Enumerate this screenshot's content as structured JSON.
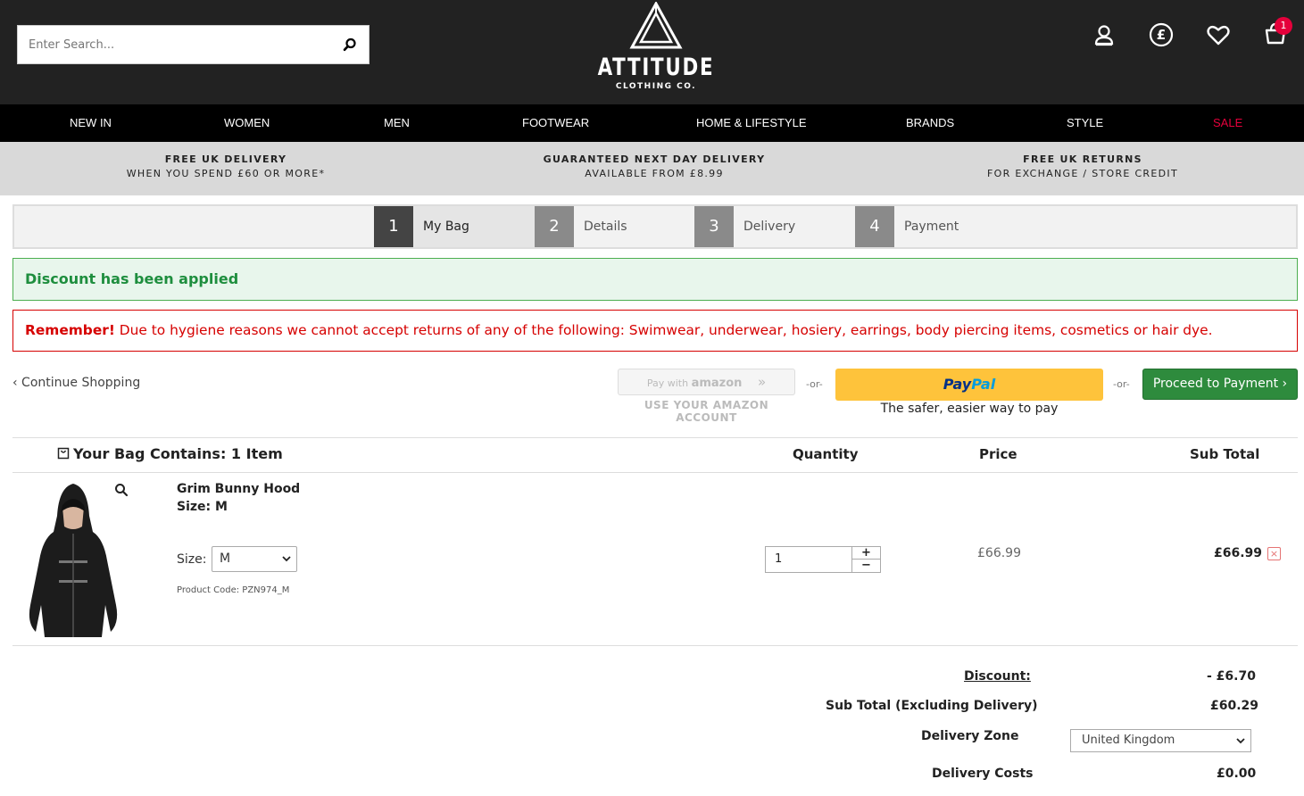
{
  "header": {
    "search_placeholder": "Enter Search...",
    "logo_name": "ATTITUDE",
    "logo_sub": "CLOTHING CO.",
    "cart_count": "1",
    "currency_symbol": "£"
  },
  "nav": {
    "items": [
      "NEW IN",
      "WOMEN",
      "MEN",
      "FOOTWEAR",
      "HOME & LIFESTYLE",
      "BRANDS",
      "STYLE",
      "SALE"
    ]
  },
  "promo": [
    {
      "title": "FREE UK DELIVERY",
      "sub": "WHEN YOU SPEND £60 OR MORE*"
    },
    {
      "title": "GUARANTEED NEXT DAY DELIVERY",
      "sub": "AVAILABLE FROM £8.99"
    },
    {
      "title": "FREE UK RETURNS",
      "sub": "FOR EXCHANGE / STORE CREDIT"
    }
  ],
  "steps": [
    {
      "num": "1",
      "label": "My Bag"
    },
    {
      "num": "2",
      "label": "Details"
    },
    {
      "num": "3",
      "label": "Delivery"
    },
    {
      "num": "4",
      "label": "Payment"
    }
  ],
  "alerts": {
    "discount": "Discount has been applied",
    "remember_bold": "Remember!",
    "remember_text": " Due to hygiene reasons we cannot accept returns of any of the following: Swimwear, underwear, hosiery, earrings, body piercing items, cosmetics or hair dye."
  },
  "actions": {
    "continue": "‹ Continue Shopping",
    "amazon_pay_with": "Pay with",
    "amazon_brand": "amazon",
    "amazon_sub": "USE YOUR AMAZON ACCOUNT",
    "or": "-or-",
    "paypal_pay": "Pay",
    "paypal_pal": "Pal",
    "paypal_sub": "The safer, easier way to pay",
    "proceed": "Proceed to Payment ›"
  },
  "table": {
    "bag_title": "Your Bag Contains: 1 Item",
    "col_quantity": "Quantity",
    "col_price": "Price",
    "col_subtotal": "Sub Total"
  },
  "item": {
    "name": "Grim Bunny Hood",
    "size_line": "Size: M",
    "size_label": "Size:",
    "size_value": "M",
    "code": "Product Code: PZN974_M",
    "quantity": "1",
    "plus": "+",
    "minus": "−",
    "price": "£66.99",
    "subtotal": "£66.99",
    "remove": "×"
  },
  "totals": {
    "discount_label": "Discount:",
    "discount_value": "- £6.70",
    "subtotal_label": "Sub Total (Excluding Delivery)",
    "subtotal_value": "£60.29",
    "zone_label": "Delivery Zone",
    "zone_value": "United Kingdom",
    "delivery_label": "Delivery Costs",
    "delivery_value": "£0.00"
  }
}
